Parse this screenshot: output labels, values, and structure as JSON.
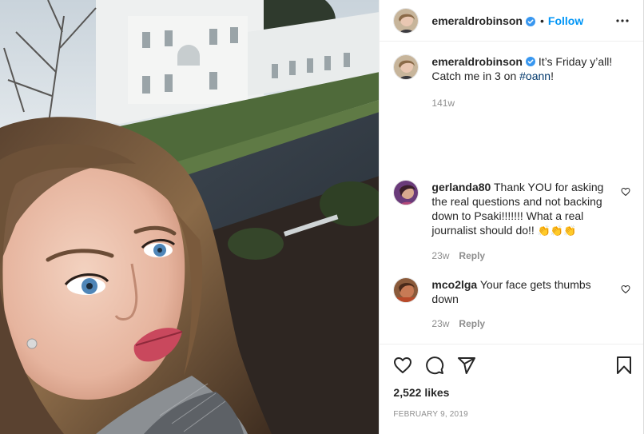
{
  "post": {
    "author": "emeraldrobinson",
    "follow_label": "Follow",
    "separator": "•",
    "caption": {
      "text_before": "It’s Friday y’all! Catch me in 3 on ",
      "hashtag": "#oann",
      "text_after": "!",
      "time": "141w"
    },
    "comments": [
      {
        "username": "gerlanda80",
        "text": "Thank YOU for asking the real questions and not backing down to Psaki!!!!!!! What a real journalist should do!! ",
        "emoji": "👏👏👏",
        "time": "23w",
        "reply_label": "Reply"
      },
      {
        "username": "mco2lga",
        "text": "Your face gets thumbs down",
        "time": "23w",
        "reply_label": "Reply"
      }
    ],
    "likes": "2,522 likes",
    "date": "FEBRUARY 9, 2019"
  },
  "icons": {
    "verified": "verified-badge-icon",
    "more": "more-options-icon",
    "like": "heart-icon",
    "comment": "comment-bubble-icon",
    "share": "paper-plane-icon",
    "save": "bookmark-icon"
  },
  "colors": {
    "accent": "#0095f6",
    "hashtag": "#00376b",
    "muted": "#8e8e8e",
    "text": "#262626"
  }
}
